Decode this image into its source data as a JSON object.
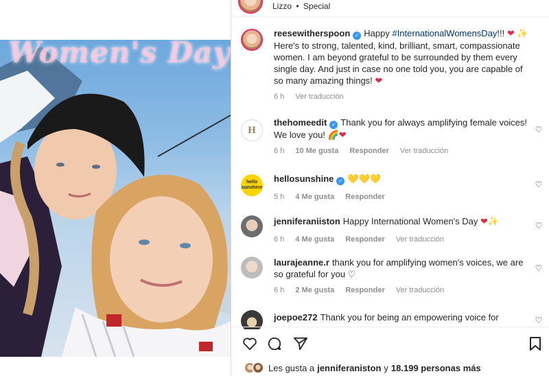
{
  "photo": {
    "overlay_title": "Women's Day"
  },
  "header": {
    "audio_artist": "Lizzo",
    "audio_separator": "•",
    "audio_track": "Special"
  },
  "caption": {
    "username": "reesewitherspoon",
    "text_before": "Happy ",
    "hashtag": "#InternationalWomensDay",
    "text_after": "!!! ",
    "emoji_1": "❤",
    "emoji_2": "✨",
    "line_rest": "Here's to strong, talented, kind, brilliant, smart, compassionate women. I am beyond grateful to be surrounded by them every single day. And just in case no one told you, you are capable of so many amazing things! ",
    "emoji_3": "❤",
    "time": "6 h",
    "translate": "Ver traducción"
  },
  "comments": [
    {
      "username": "thehomeedit",
      "text": "Thank you for always amplifying female voices! We love you! ",
      "emoji": "🌈❤",
      "time": "6 h",
      "likes": "10 Me gusta",
      "reply": "Responder",
      "translate": "Ver traducción"
    },
    {
      "username": "hellosunshine",
      "text": "",
      "emoji": "💛💛💛",
      "time": "5 h",
      "likes": "4 Me gusta",
      "reply": "Responder",
      "translate": ""
    },
    {
      "username": "jenniferaniiston",
      "text": "Happy International Women's Day ",
      "emoji": "❤✨",
      "time": "6 h",
      "likes": "4 Me gusta",
      "reply": "Responder",
      "translate": "Ver traducción"
    },
    {
      "username": "laurajeanne.r",
      "text": "thank you for amplifying women's voices, we are so grateful for you ",
      "emoji": "♡",
      "time": "6 h",
      "likes": "2 Me gusta",
      "reply": "Responder",
      "translate": "Ver traducción"
    },
    {
      "username": "joepoe272",
      "text": "Thank you for being an empowering voice for",
      "emoji": "",
      "time": "",
      "likes": "",
      "reply": "",
      "translate": ""
    }
  ],
  "likes_line": {
    "prefix": "Les gusta a",
    "user": "jenniferaniston",
    "middle": "y",
    "count": "18.199 personas más"
  },
  "avatar_text": {
    "hellosunshine": "hello sunshine",
    "thehomeedit": "H"
  },
  "colors": {
    "verified": "#3897f0",
    "hashtag": "#00376b",
    "meta_gray": "#8e8e8e",
    "story_ring": "#e1306c"
  }
}
